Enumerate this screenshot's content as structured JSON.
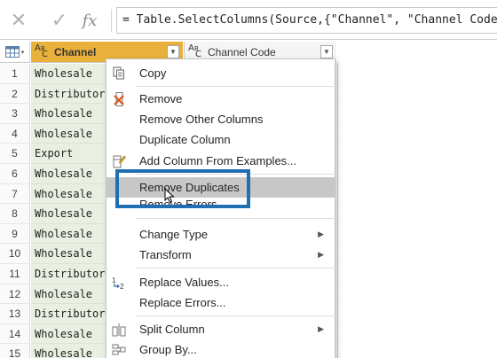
{
  "formula_bar": {
    "cancel_icon": "close-icon",
    "confirm_icon": "check-icon",
    "fx_label": "fx",
    "formula": "= Table.SelectColumns(Source,{\"Channel\", \"Channel Code\"})"
  },
  "table": {
    "columns": [
      {
        "type_icon": "ABC",
        "label": "Channel",
        "selected": true
      },
      {
        "type_icon": "ABC",
        "label": "Channel Code",
        "selected": false
      }
    ],
    "rows": [
      {
        "num": "1",
        "channel": "Wholesale"
      },
      {
        "num": "2",
        "channel": "Distributor"
      },
      {
        "num": "3",
        "channel": "Wholesale"
      },
      {
        "num": "4",
        "channel": "Wholesale"
      },
      {
        "num": "5",
        "channel": "Export"
      },
      {
        "num": "6",
        "channel": "Wholesale"
      },
      {
        "num": "7",
        "channel": "Wholesale"
      },
      {
        "num": "8",
        "channel": "Wholesale"
      },
      {
        "num": "9",
        "channel": "Wholesale"
      },
      {
        "num": "10",
        "channel": "Wholesale"
      },
      {
        "num": "11",
        "channel": "Distributor"
      },
      {
        "num": "12",
        "channel": "Wholesale"
      },
      {
        "num": "13",
        "channel": "Distributor"
      },
      {
        "num": "14",
        "channel": "Wholesale"
      },
      {
        "num": "15",
        "channel": "Wholesale"
      }
    ],
    "colors": {
      "selected_header": "#e9b13b",
      "selected_cells": "#e9f0e2"
    }
  },
  "context_menu": {
    "items": [
      {
        "label": "Copy",
        "icon": "copy-icon",
        "submenu": false
      },
      {
        "label": "Remove",
        "icon": "remove-column-icon",
        "submenu": false
      },
      {
        "label": "Remove Other Columns",
        "icon": "",
        "submenu": false
      },
      {
        "label": "Duplicate Column",
        "icon": "",
        "submenu": false
      },
      {
        "label": "Add Column From Examples...",
        "icon": "add-column-examples-icon",
        "submenu": false
      },
      {
        "label": "Remove Duplicates",
        "icon": "",
        "submenu": false,
        "hovered": true
      },
      {
        "label": "Remove Errors",
        "icon": "",
        "submenu": false
      },
      {
        "label": "Change Type",
        "icon": "",
        "submenu": true
      },
      {
        "label": "Transform",
        "icon": "",
        "submenu": true
      },
      {
        "label": "Replace Values...",
        "icon": "replace-values-icon",
        "submenu": false
      },
      {
        "label": "Replace Errors...",
        "icon": "",
        "submenu": false
      },
      {
        "label": "Split Column",
        "icon": "split-column-icon",
        "submenu": true
      },
      {
        "label": "Group By...",
        "icon": "group-by-icon",
        "submenu": false
      }
    ],
    "highlight_color": "#1f6fb3"
  }
}
